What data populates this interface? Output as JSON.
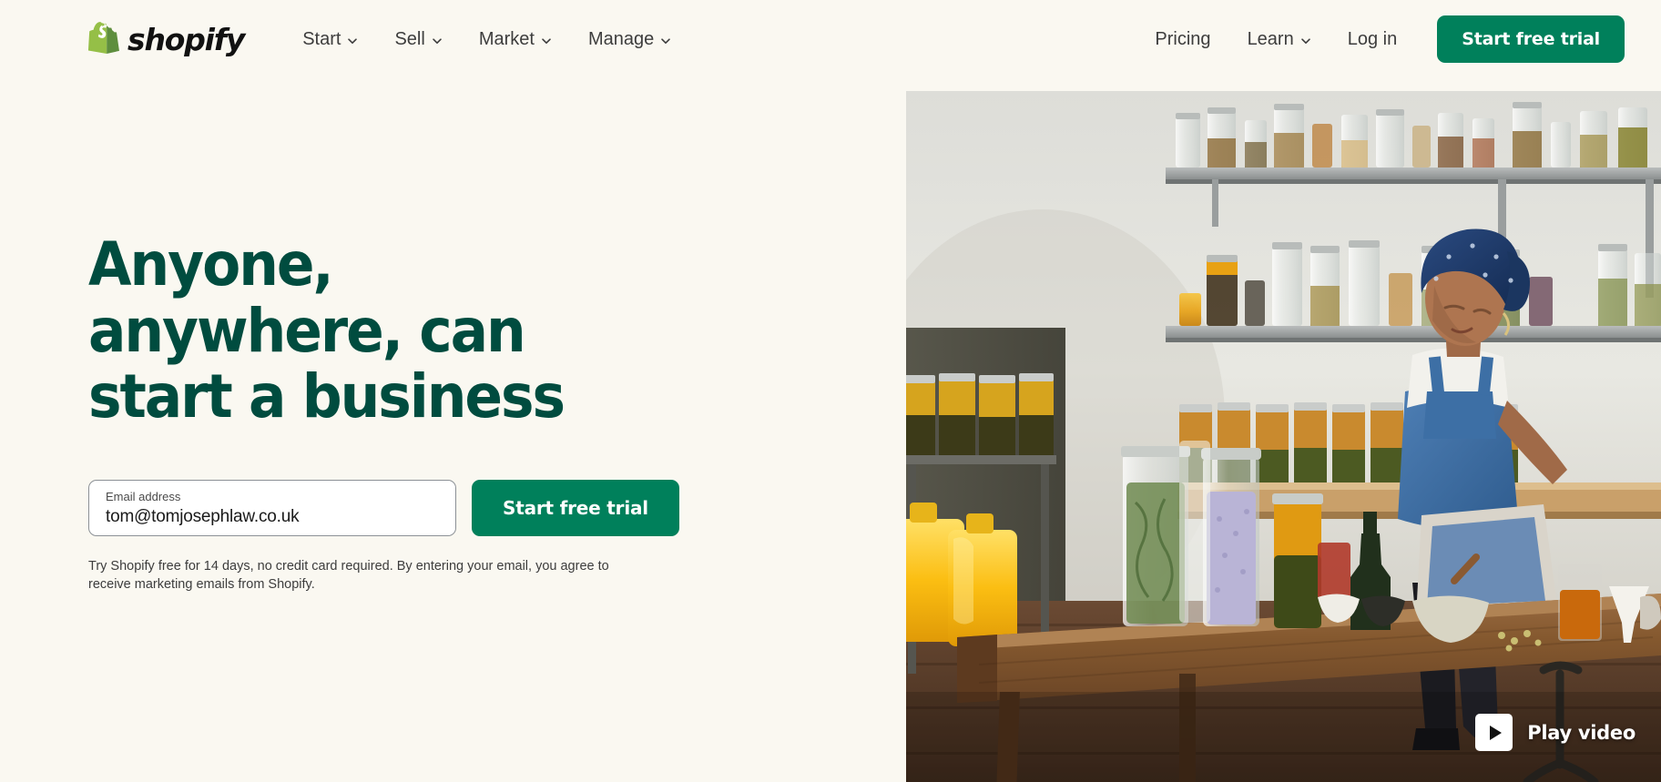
{
  "header": {
    "brand": {
      "word": "shopify",
      "icon": "shopify-bag-logo"
    },
    "nav_primary": [
      {
        "label": "Start",
        "has_dropdown": true
      },
      {
        "label": "Sell",
        "has_dropdown": true
      },
      {
        "label": "Market",
        "has_dropdown": true
      },
      {
        "label": "Manage",
        "has_dropdown": true
      }
    ],
    "nav_right": [
      {
        "label": "Pricing",
        "has_dropdown": false
      },
      {
        "label": "Learn",
        "has_dropdown": true
      },
      {
        "label": "Log in",
        "has_dropdown": false
      }
    ],
    "cta_label": "Start free trial"
  },
  "hero": {
    "headline_line1": "Anyone, anywhere, can",
    "headline_line2": "start a business",
    "email": {
      "label": "Email address",
      "value": "tom@tomjosephlaw.co.uk",
      "placeholder": "Email address"
    },
    "cta_label": "Start free trial",
    "disclaimer": "Try Shopify free for 14 days, no credit card required. By entering your email, you agree to receive marketing emails from Shopify."
  },
  "media": {
    "play_video_label": "Play video",
    "alt": "Woman in navy headwrap and denim overalls working on a laptop at a wooden table in an artisan food shop with shelves of glass jars"
  },
  "colors": {
    "background": "#FAF8F1",
    "brand_green": "#00805B",
    "headline_green": "#004C3F",
    "logo_green": "#95BF47",
    "text": "#3D3D3D"
  }
}
